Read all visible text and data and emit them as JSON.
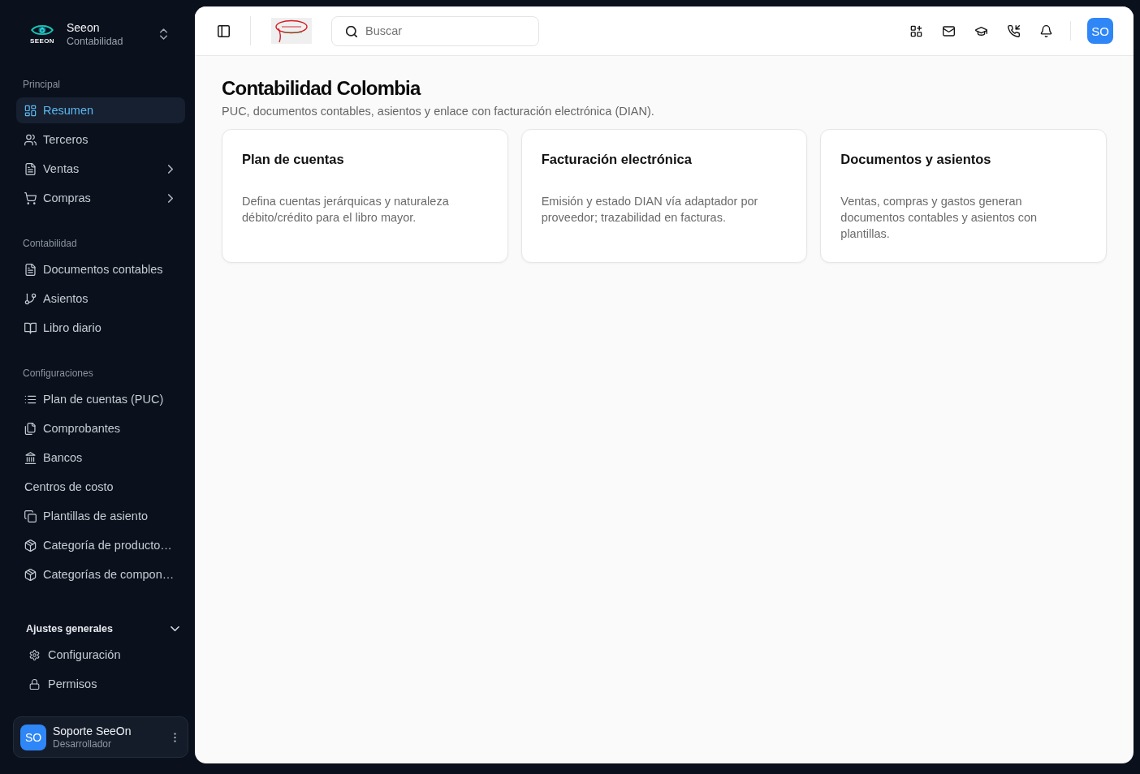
{
  "sidebar": {
    "brand": {
      "logo_text": "SEEON",
      "name": "Seeon",
      "subtitle": "Contabilidad"
    },
    "sections": [
      {
        "label": "Principal",
        "items": [
          {
            "label": "Resumen",
            "kind": "link",
            "selected": true
          },
          {
            "label": "Terceros",
            "kind": "link",
            "selected": false
          },
          {
            "label": "Ventas",
            "kind": "menu",
            "expanded": false,
            "selected": false
          },
          {
            "label": "Compras",
            "kind": "menu",
            "expanded": false,
            "selected": false
          }
        ]
      },
      {
        "label": "Contabilidad",
        "items": [
          {
            "label": "Documentos contables",
            "kind": "link",
            "selected": false
          },
          {
            "label": "Asientos",
            "kind": "link",
            "selected": false
          },
          {
            "label": "Libro diario",
            "kind": "link",
            "selected": false
          }
        ]
      },
      {
        "label": "Configuraciones",
        "items": [
          {
            "label": "Plan de cuentas (PUC)",
            "kind": "link",
            "selected": false
          },
          {
            "label": "Comprobantes",
            "kind": "link",
            "selected": false
          },
          {
            "label": "Bancos",
            "kind": "link",
            "selected": false
          },
          {
            "label": "Centros de costo",
            "kind": "link",
            "selected": false
          },
          {
            "label": "Plantillas de asiento",
            "kind": "link",
            "selected": false
          },
          {
            "label": "Categoría de producto…",
            "kind": "link",
            "selected": false
          },
          {
            "label": "Categorías de compon…",
            "kind": "link",
            "selected": false
          }
        ]
      }
    ],
    "settings": {
      "label": "Ajustes generales",
      "expanded": true,
      "items": [
        {
          "label": "Configuración",
          "selected": false
        },
        {
          "label": "Permisos",
          "selected": false
        }
      ]
    },
    "user": {
      "initials": "SO",
      "name": "Soporte SeeOn",
      "role": "Desarrollador"
    }
  },
  "header": {
    "search": {
      "placeholder": "Buscar"
    },
    "avatar": {
      "initials": "SO"
    }
  },
  "page": {
    "title": "Contabilidad Colombia",
    "subtitle": "PUC, documentos contables, asientos y enlace con facturación electrónica (DIAN).",
    "cards": [
      {
        "title": "Plan de cuentas",
        "description": "Defina cuentas jerárquicas y naturaleza débito/crédito para el libro mayor."
      },
      {
        "title": "Facturación electrónica",
        "description": "Emisión y estado DIAN vía adaptador por proveedor; trazabilidad en facturas."
      },
      {
        "title": "Documentos y asientos",
        "description": "Ventas, compras y gastos generan documentos contables y asientos con plantillas."
      }
    ]
  }
}
